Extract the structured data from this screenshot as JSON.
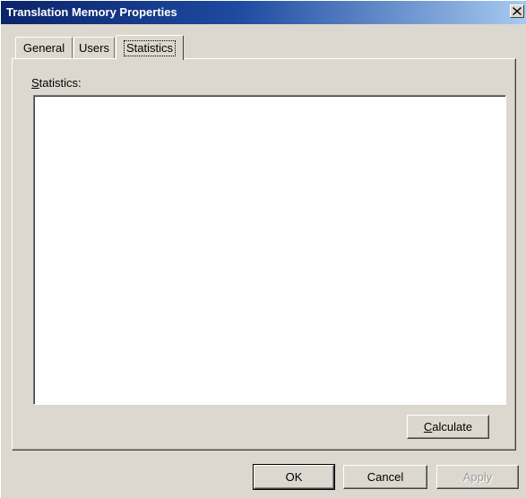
{
  "window": {
    "title": "Translation Memory Properties",
    "close_glyph": "×"
  },
  "tabs": [
    {
      "label": "General",
      "selected": false
    },
    {
      "label": "Users",
      "selected": false
    },
    {
      "label": "Statistics",
      "selected": true
    }
  ],
  "statistics": {
    "label_prefix": "S",
    "label_rest": "tatistics:",
    "content": ""
  },
  "buttons": {
    "calculate_prefix": "C",
    "calculate_rest": "alculate",
    "ok": "OK",
    "cancel": "Cancel",
    "apply": "Apply"
  },
  "colors": {
    "title_gradient_start": "#0a246a",
    "title_gradient_end": "#a6caf0",
    "face": "#dcd8cf"
  }
}
